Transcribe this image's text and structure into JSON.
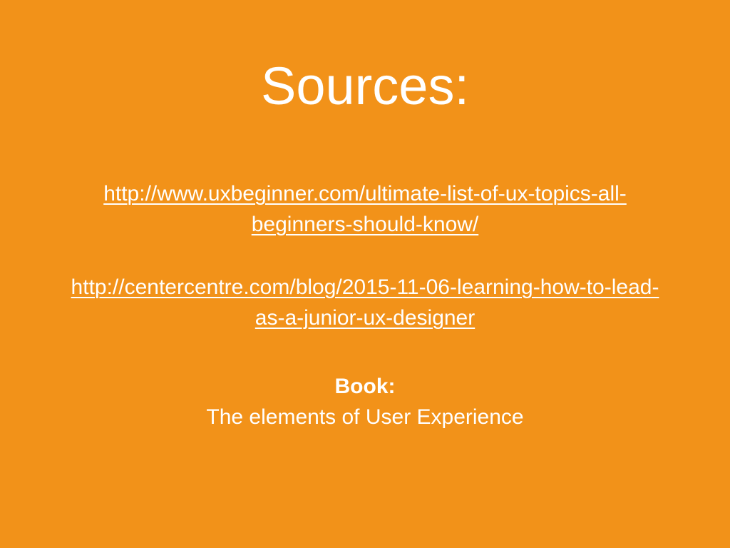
{
  "slide": {
    "background_color": "#f29219",
    "text_color": "#ffffff",
    "title": "Sources:",
    "links": [
      {
        "line1": "http://www.uxbeginner.com/ultimate-list-of-ux-topics-all-",
        "line2": "beginners-should-know/"
      },
      {
        "line1": "http://centercentre.com/blog/2015-11-06-learning-how-to-lead-",
        "line2": "as-a-junior-ux-designer"
      }
    ],
    "book": {
      "label": "Book:",
      "title": "The elements of User Experience"
    }
  }
}
